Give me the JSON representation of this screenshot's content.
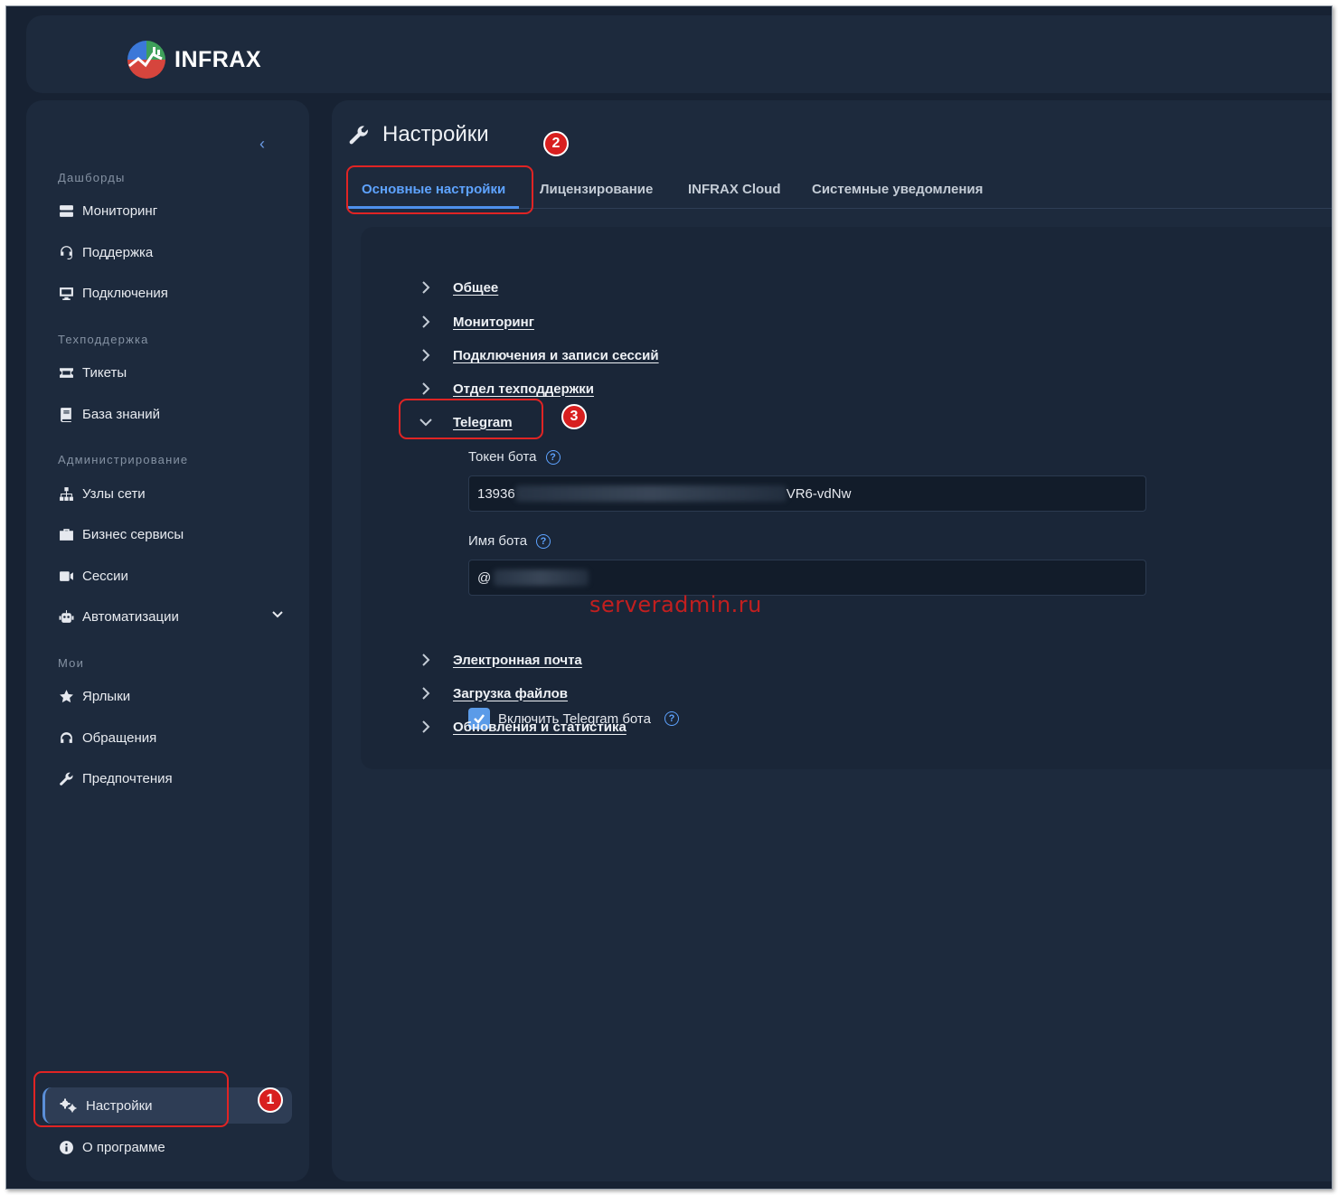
{
  "app": {
    "logo_text": "INFRAX"
  },
  "sidebar": {
    "collapse_glyph": "‹",
    "sections": [
      {
        "title": "Дашборды"
      },
      {
        "title": "Техподдержка"
      },
      {
        "title": "Администрирование"
      },
      {
        "title": "Мои"
      }
    ],
    "items": [
      {
        "label": "Мониторинг",
        "icon": "server-icon"
      },
      {
        "label": "Поддержка",
        "icon": "headset-icon"
      },
      {
        "label": "Подключения",
        "icon": "monitor-icon"
      },
      {
        "label": "Тикеты",
        "icon": "ticket-icon"
      },
      {
        "label": "База знаний",
        "icon": "book-icon"
      },
      {
        "label": "Узлы сети",
        "icon": "network-icon"
      },
      {
        "label": "Бизнес сервисы",
        "icon": "briefcase-icon"
      },
      {
        "label": "Сессии",
        "icon": "video-icon"
      },
      {
        "label": "Автоматизации",
        "icon": "robot-icon"
      },
      {
        "label": "Ярлыки",
        "icon": "star-icon"
      },
      {
        "label": "Обращения",
        "icon": "headphones-icon"
      },
      {
        "label": "Предпочтения",
        "icon": "wrench-icon"
      }
    ],
    "settings_label": "Настройки",
    "about_label": "О программе"
  },
  "page": {
    "title": "Настройки",
    "tabs": [
      {
        "label": "Основные настройки",
        "active": true
      },
      {
        "label": "Лицензирование"
      },
      {
        "label": "INFRAX Cloud"
      },
      {
        "label": "Системные уведомления"
      }
    ],
    "sections": [
      {
        "label": "Общее",
        "expanded": false
      },
      {
        "label": "Мониторинг",
        "expanded": false
      },
      {
        "label": "Подключения и записи сессий",
        "expanded": false
      },
      {
        "label": "Отдел техподдержки",
        "expanded": false
      },
      {
        "label": "Telegram",
        "expanded": true
      },
      {
        "label": "Электронная почта",
        "expanded": false
      },
      {
        "label": "Загрузка файлов",
        "expanded": false
      },
      {
        "label": "Обновления и статистика",
        "expanded": false
      }
    ],
    "telegram": {
      "token_label": "Токен бота",
      "token_prefix": "13936",
      "token_suffix": "VR6-vdNw",
      "name_label": "Имя бота",
      "name_prefix": "@",
      "enable_label": "Включить Telegram бота",
      "enabled": true
    }
  },
  "annotations": {
    "badges": [
      "1",
      "2",
      "3"
    ],
    "watermark": "serveradmin.ru"
  },
  "colors": {
    "background": "#172233",
    "panel": "#1d2a3d",
    "accent": "#5ea3ff",
    "highlight": "#e02424"
  }
}
